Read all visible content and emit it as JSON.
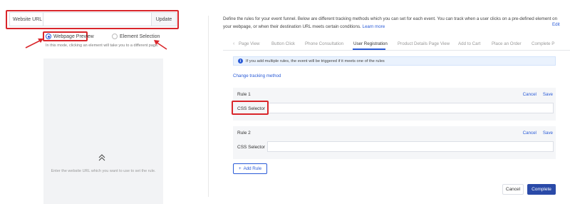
{
  "left_panel": {
    "url_label": "Website URL",
    "url_value": "",
    "update_label": "Update",
    "radio_options": [
      {
        "label": "Webpage Preview",
        "selected": true
      },
      {
        "label": "Element Selection",
        "selected": false
      }
    ],
    "hint": "In this mode, clicking an element will take you to a different page.",
    "preview_icon": "double-chevron-up-icon",
    "preview_text": "Enter the website URL which you want to use to set the rule."
  },
  "right_panel": {
    "description_line1": "Define the rules for your event funnel. Below are different tracking methods which you can set for each event. You can track when a user clicks on a pre-defined element on",
    "description_line2": "your webpage, or when their destination URL meets certain conditions.",
    "learn_more": "Learn more",
    "edit_label": "Edit",
    "tabs": [
      {
        "label": "Page View",
        "active": false
      },
      {
        "label": "Button Click",
        "active": false
      },
      {
        "label": "Phone Consultation",
        "active": false
      },
      {
        "label": "User Registration",
        "active": true
      },
      {
        "label": "Product Details Page View",
        "active": false
      },
      {
        "label": "Add to Cart",
        "active": false
      },
      {
        "label": "Place an Order",
        "active": false
      },
      {
        "label": "Complete P",
        "active": false
      }
    ],
    "info_text": "If you add multiple rules, the event will be triggered if it meets one of the rules",
    "change_tracking": "Change tracking method",
    "rules": [
      {
        "title": "Rule 1",
        "cancel": "Cancel",
        "save": "Save",
        "field_label": "CSS Selector",
        "value": ""
      },
      {
        "title": "Rule 2",
        "cancel": "Cancel",
        "save": "Save",
        "field_label": "CSS Selector",
        "value": ""
      }
    ],
    "add_rule": "Add Rule",
    "cancel_label": "Cancel",
    "complete_label": "Complete"
  },
  "colors": {
    "accent": "#2a5bd7",
    "primary_button": "#2a4aa8",
    "highlight": "#d9262b",
    "preview_bg": "#f2f3f5"
  }
}
